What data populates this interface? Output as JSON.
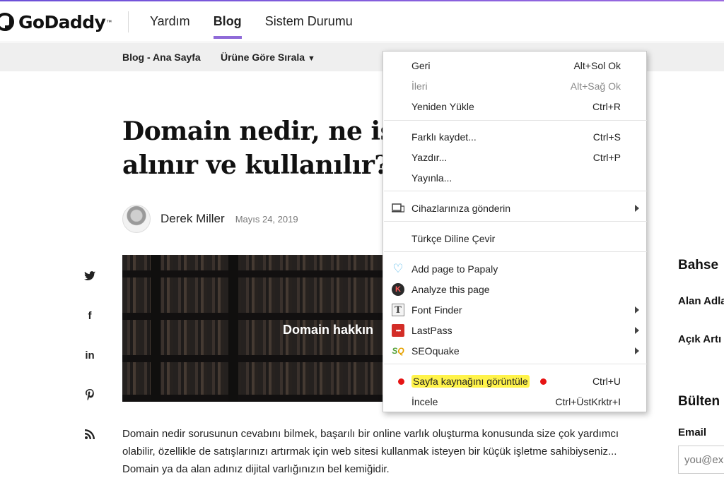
{
  "header": {
    "logo_text": "GoDaddy",
    "nav": [
      "Yardım",
      "Blog",
      "Sistem Durumu"
    ],
    "active_nav": "Blog"
  },
  "subnav": {
    "home": "Blog - Ana Sayfa",
    "sort": "Ürüne Göre Sırala"
  },
  "article": {
    "title_line1": "Domain nedir, ne iş",
    "title_line2": "alınır ve kullanılır?",
    "author": "Derek Miller",
    "date": "Mayıs 24, 2019",
    "hero_text": "Domain hakkın",
    "body": "Domain nedir sorusunun cevabını bilmek, başarılı bir online varlık oluşturma konusunda size çok yardımcı olabilir, özellikle de satışlarınızı artırmak için web sitesi kullanmak isteyen bir küçük işletme sahibiyseniz... Domain ya da alan adınız dijital varlığınızın bel kemiğidir."
  },
  "social_icons": [
    "twitter-icon",
    "facebook-icon",
    "linkedin-icon",
    "pinterest-icon",
    "rss-icon"
  ],
  "sidebar": {
    "heading1": "Bahse",
    "link1": "Alan Adla",
    "link2": "Açık Artı",
    "heading2": "Bülten",
    "email_label": "Email",
    "email_placeholder": "you@ex"
  },
  "context_menu": {
    "items": [
      {
        "label": "Geri",
        "shortcut": "Alt+Sol Ok",
        "disabled": false
      },
      {
        "label": "İleri",
        "shortcut": "Alt+Sağ Ok",
        "disabled": true
      },
      {
        "label": "Yeniden Yükle",
        "shortcut": "Ctrl+R",
        "disabled": false
      },
      {
        "label": "Farklı kaydet...",
        "shortcut": "Ctrl+S",
        "disabled": false
      },
      {
        "label": "Yazdır...",
        "shortcut": "Ctrl+P",
        "disabled": false
      },
      {
        "label": "Yayınla...",
        "shortcut": "",
        "disabled": false
      },
      {
        "label": "Cihazlarınıza gönderin",
        "shortcut": "",
        "submenu": true,
        "icon": "devices-icon"
      },
      {
        "label": "Türkçe Diline Çevir",
        "shortcut": ""
      },
      {
        "label": "Add page to Papaly",
        "shortcut": "",
        "icon": "papaly-heart-icon"
      },
      {
        "label": "Analyze this page",
        "shortcut": "",
        "icon": "kontent-k-icon"
      },
      {
        "label": "Font Finder",
        "shortcut": "",
        "submenu": true,
        "icon": "font-finder-icon"
      },
      {
        "label": "LastPass",
        "shortcut": "",
        "submenu": true,
        "icon": "lastpass-icon"
      },
      {
        "label": "SEOquake",
        "shortcut": "",
        "submenu": true,
        "icon": "seoquake-icon"
      },
      {
        "label": "Sayfa kaynağını görüntüle",
        "shortcut": "Ctrl+U",
        "highlighted": true
      },
      {
        "label": "İncele",
        "shortcut": "Ctrl+ÜstKrktr+I"
      }
    ]
  },
  "colors": {
    "accent_nav": "#8f6ad8",
    "highlight": "#fff34a",
    "annotation_dot": "#e61414"
  }
}
